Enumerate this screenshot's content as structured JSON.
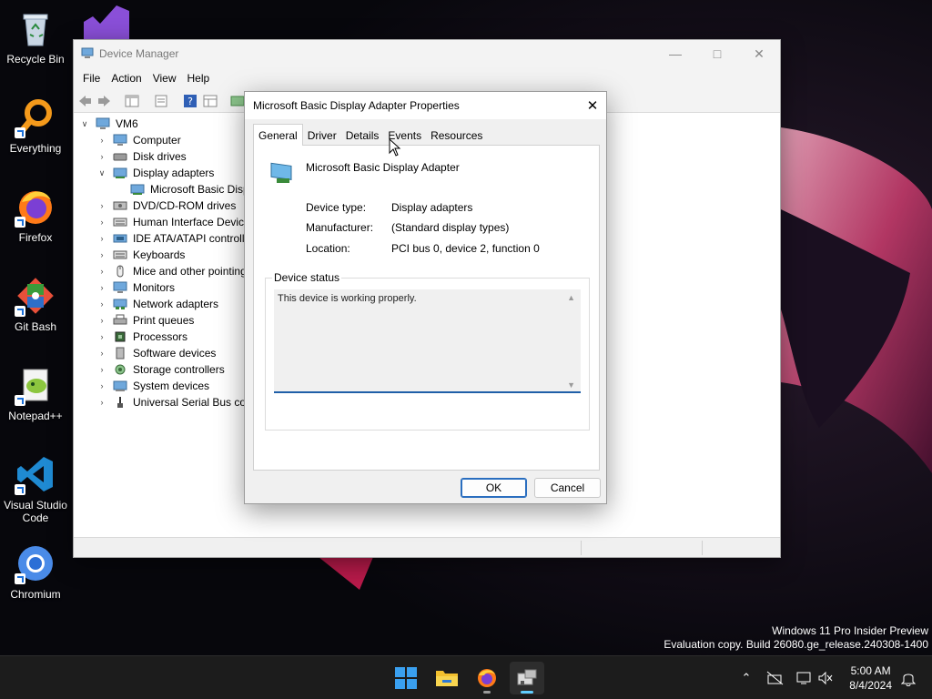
{
  "desktop": {
    "icons": [
      {
        "label": "Recycle Bin"
      },
      {
        "label": "Everything"
      },
      {
        "label": "Firefox"
      },
      {
        "label": "Git Bash"
      },
      {
        "label": "Notepad++"
      },
      {
        "label": "Visual Studio Code"
      },
      {
        "label": "Chromium"
      }
    ],
    "watermark": {
      "line1": "Windows 11 Pro Insider Preview",
      "line2": "Evaluation copy. Build 26080.ge_release.240308-1400"
    }
  },
  "device_manager": {
    "title": "Device Manager",
    "menu": [
      "File",
      "Action",
      "View",
      "Help"
    ],
    "tree": {
      "root": "VM6",
      "items": [
        {
          "label": "Computer",
          "expanded": false
        },
        {
          "label": "Disk drives",
          "expanded": false
        },
        {
          "label": "Display adapters",
          "expanded": true
        },
        {
          "label": "Microsoft Basic Disp",
          "child": true
        },
        {
          "label": "DVD/CD-ROM drives",
          "expanded": false
        },
        {
          "label": "Human Interface Device",
          "expanded": false
        },
        {
          "label": "IDE ATA/ATAPI controlle",
          "expanded": false
        },
        {
          "label": "Keyboards",
          "expanded": false
        },
        {
          "label": "Mice and other pointing",
          "expanded": false
        },
        {
          "label": "Monitors",
          "expanded": false
        },
        {
          "label": "Network adapters",
          "expanded": false
        },
        {
          "label": "Print queues",
          "expanded": false
        },
        {
          "label": "Processors",
          "expanded": false
        },
        {
          "label": "Software devices",
          "expanded": false
        },
        {
          "label": "Storage controllers",
          "expanded": false
        },
        {
          "label": "System devices",
          "expanded": false
        },
        {
          "label": "Universal Serial Bus cont",
          "expanded": false
        }
      ]
    }
  },
  "properties_dialog": {
    "title": "Microsoft Basic Display Adapter Properties",
    "tabs": [
      "General",
      "Driver",
      "Details",
      "Events",
      "Resources"
    ],
    "active_tab": "General",
    "device_name": "Microsoft Basic Display Adapter",
    "properties": [
      {
        "label": "Device type:",
        "value": "Display adapters"
      },
      {
        "label": "Manufacturer:",
        "value": "(Standard display types)"
      },
      {
        "label": "Location:",
        "value": "PCI bus 0, device 2, function 0"
      }
    ],
    "status_group_label": "Device status",
    "status_text": "This device is working properly.",
    "ok_label": "OK",
    "cancel_label": "Cancel"
  },
  "taskbar": {
    "time": "5:00 AM",
    "date": "8/4/2024"
  },
  "colors": {
    "accent": "#60cdff",
    "focus_blue": "#1f5fa8",
    "taskbar_bg": "#1c1c1c"
  }
}
